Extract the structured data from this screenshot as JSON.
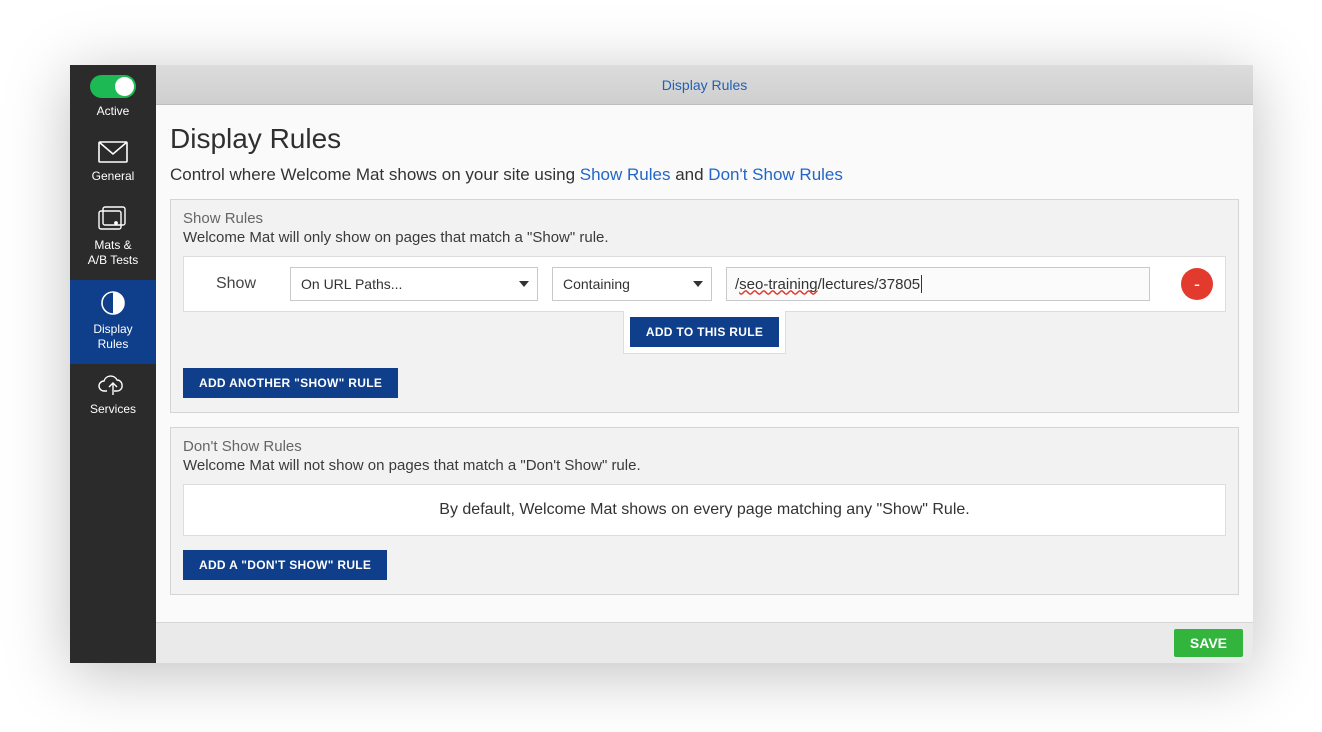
{
  "sidebar": {
    "items": [
      {
        "label": "Active"
      },
      {
        "label": "General"
      },
      {
        "label": "Mats &\nA/B Tests"
      },
      {
        "label": "Display\nRules"
      },
      {
        "label": "Services"
      }
    ]
  },
  "tabbar": {
    "title": "Display Rules"
  },
  "page": {
    "title": "Display Rules",
    "subtitle_pre": "Control where Welcome Mat shows on your site using ",
    "subtitle_link1": "Show Rules",
    "subtitle_mid": " and ",
    "subtitle_link2": "Don't Show Rules"
  },
  "show_panel": {
    "head": "Show Rules",
    "desc": "Welcome Mat will only show on pages that match a \"Show\" rule.",
    "row": {
      "label": "Show",
      "select_condition": "On URL Paths...",
      "select_match": "Containing",
      "url_plain": "/seo-training/lectures/37805",
      "url_marked": "seo-training",
      "remove": "-"
    },
    "add_to_rule": "ADD TO THIS RULE",
    "add_another": "ADD ANOTHER \"SHOW\" RULE"
  },
  "dont_panel": {
    "head": "Don't Show Rules",
    "desc": "Welcome Mat will not show on pages that match a \"Don't Show\" rule.",
    "default_msg": "By default, Welcome Mat shows on every page matching any \"Show\" Rule.",
    "add_rule": "ADD A \"DON'T SHOW\" RULE"
  },
  "footer": {
    "save": "SAVE"
  }
}
